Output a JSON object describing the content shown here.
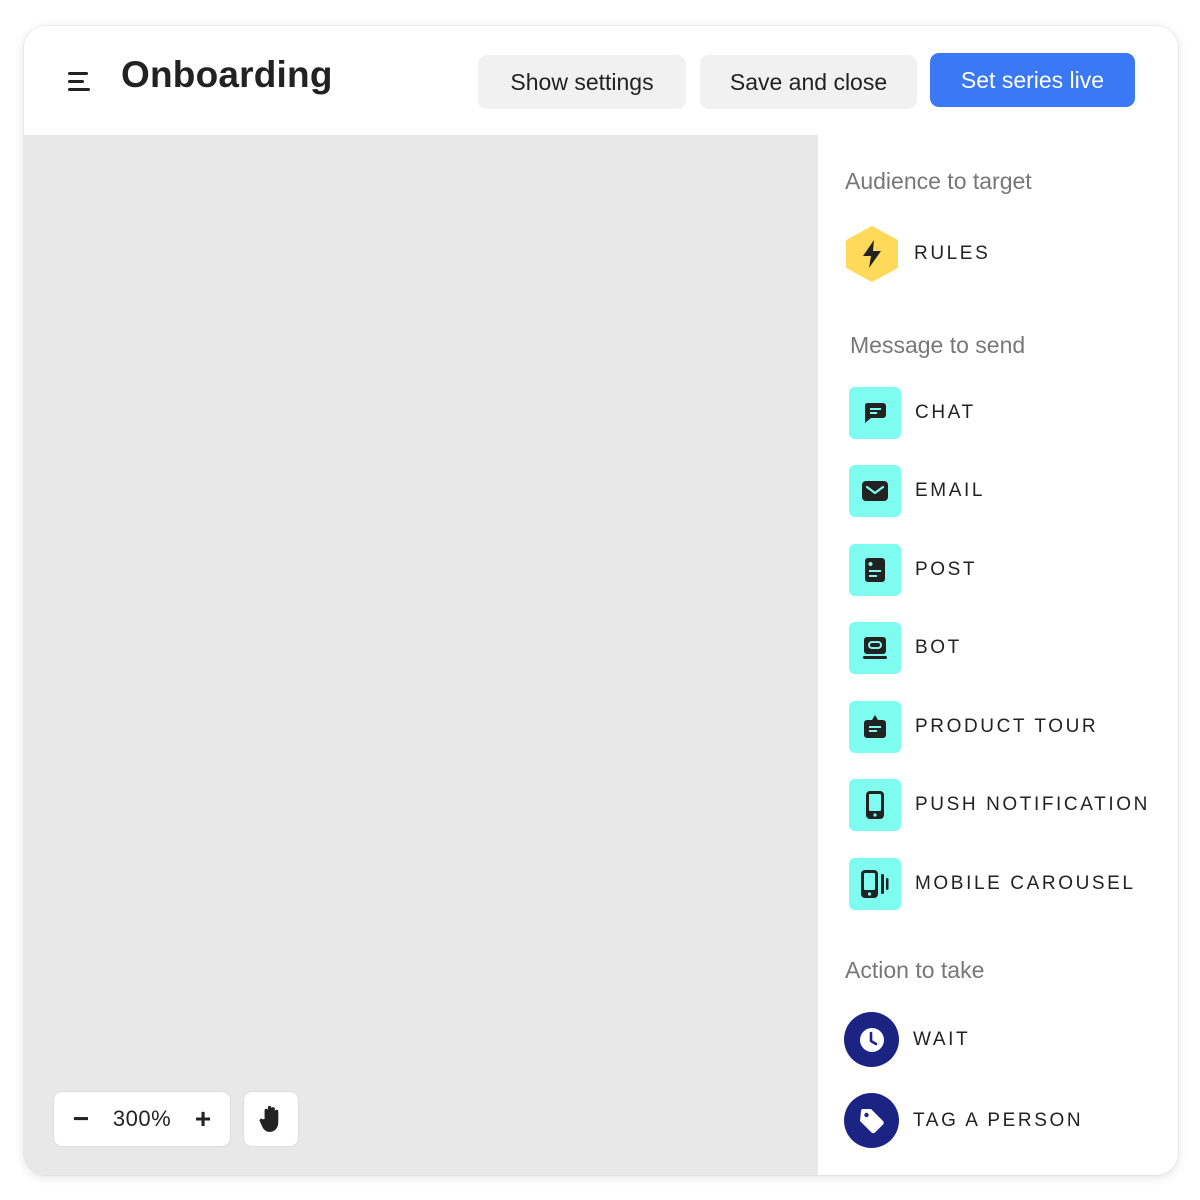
{
  "header": {
    "title": "Onboarding",
    "menu_icon": "hamburger-menu-icon",
    "buttons": {
      "show_settings": "Show settings",
      "save_and_close": "Save and close",
      "set_series_live": "Set series live"
    }
  },
  "colors": {
    "primary": "#3b78f6",
    "message_tile": "#7ffcf0",
    "rules_tile": "#ffd95a",
    "action_tile": "#1c2483",
    "canvas": "#e8e8e8"
  },
  "sidebar": {
    "audience": {
      "title": "Audience to target",
      "items": [
        {
          "label": "RULES",
          "icon": "lightning-bolt-icon"
        }
      ]
    },
    "messages": {
      "title": "Message to send",
      "items": [
        {
          "label": "CHAT",
          "icon": "chat-bubble-icon"
        },
        {
          "label": "EMAIL",
          "icon": "envelope-icon"
        },
        {
          "label": "POST",
          "icon": "post-icon"
        },
        {
          "label": "BOT",
          "icon": "bot-icon"
        },
        {
          "label": "PRODUCT TOUR",
          "icon": "product-tour-icon"
        },
        {
          "label": "PUSH NOTIFICATION",
          "icon": "mobile-phone-icon"
        },
        {
          "label": "MOBILE CAROUSEL",
          "icon": "mobile-carousel-icon"
        }
      ]
    },
    "actions": {
      "title": "Action to take",
      "items": [
        {
          "label": "WAIT",
          "icon": "clock-icon"
        },
        {
          "label": "TAG A PERSON",
          "icon": "tag-icon"
        }
      ]
    }
  },
  "canvas_controls": {
    "zoom_level": "300%",
    "zoom_out": "−",
    "zoom_in": "+",
    "hand_icon": "hand-pan-icon"
  }
}
